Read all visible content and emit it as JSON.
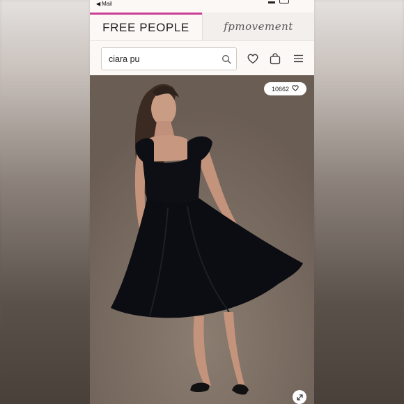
{
  "status_bar": {
    "back_label": "Mail"
  },
  "brand_tabs": {
    "primary": "FREE PEOPLE",
    "secondary": "fpmovement"
  },
  "search": {
    "query": "ciara pu"
  },
  "product": {
    "like_count": "10662"
  },
  "colors": {
    "accent": "#c93f93",
    "dress": "#0d0f14",
    "background": "#7b6d62"
  },
  "icons": [
    "back-chevron-icon",
    "search-icon",
    "heart-icon",
    "bag-icon",
    "menu-icon",
    "expand-icon"
  ]
}
